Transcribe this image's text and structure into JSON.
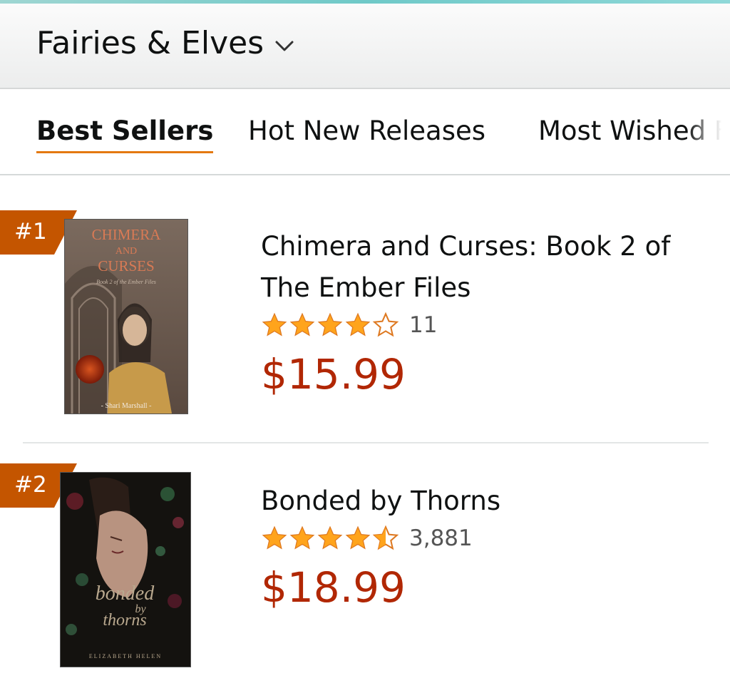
{
  "header": {
    "category": "Fairies & Elves"
  },
  "tabs": [
    "Best Sellers",
    "Hot New Releases",
    "Most Wished F"
  ],
  "items": [
    {
      "rank": "#1",
      "title_line1": "Chimera and Curses: Book 2 of",
      "title_line2": "The Ember Files",
      "rating": 4,
      "rating_count": "11",
      "price": "$15.99",
      "cover_title": [
        "CHIMERA",
        "AND",
        "CURSES"
      ],
      "cover_subtitle": "Book 2 of the Ember Files",
      "cover_author": "- Shari Marshall -"
    },
    {
      "rank": "#2",
      "title": "Bonded by Thorns",
      "rating": 4.5,
      "rating_count": "3,881",
      "price": "$18.99",
      "cover_title": [
        "bonded",
        "by",
        "thorns"
      ],
      "cover_author": "ELIZABETH HELEN"
    }
  ],
  "colors": {
    "price": "#b12704",
    "rank_badge": "#c45500",
    "star": "#ffa41c",
    "tab_underline": "#e47911"
  }
}
